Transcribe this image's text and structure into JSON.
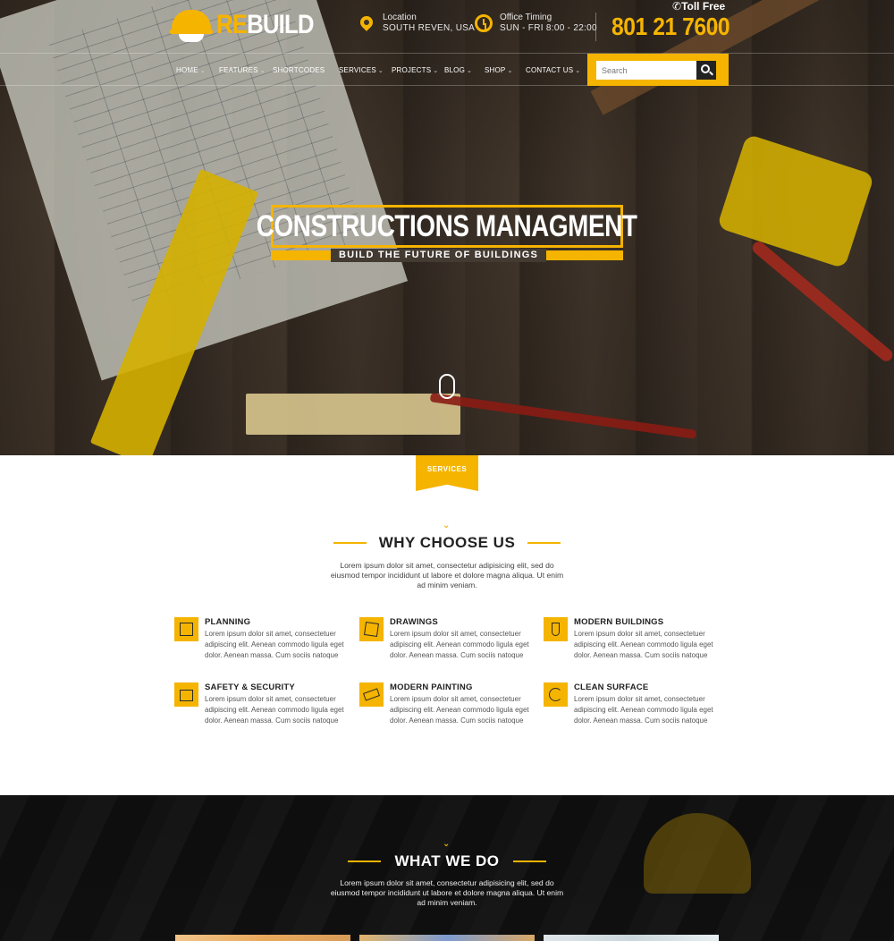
{
  "brand": {
    "name_prefix": "RE",
    "name_suffix": "BUILD"
  },
  "header": {
    "location_label": "Location",
    "location_value": "SOUTH REVEN, USA",
    "timing_label": "Office Timing",
    "timing_value": "SUN - FRI 8:00 - 22:00",
    "tollfree_label": "Toll Free",
    "phone": "801 21 7600"
  },
  "nav": {
    "items": [
      {
        "label": "HOME",
        "has_dropdown": true
      },
      {
        "label": "FEATURES",
        "has_dropdown": true
      },
      {
        "label": "SHORTCODES",
        "has_dropdown": false
      },
      {
        "label": "SERVICES",
        "has_dropdown": true
      },
      {
        "label": "PROJECTS",
        "has_dropdown": true
      },
      {
        "label": "BLOG",
        "has_dropdown": true
      },
      {
        "label": "SHOP",
        "has_dropdown": true
      },
      {
        "label": "CONTACT US",
        "has_dropdown": true
      }
    ],
    "search_placeholder": "Search"
  },
  "hero": {
    "title": "CONSTRUCTIONS MANAGMENT",
    "subtitle": "BUILD THE FUTURE OF BUILDINGS"
  },
  "services": {
    "tag": "SERVICES",
    "heading": "WHY CHOOSE US",
    "intro": "Lorem ipsum dolor sit amet, consectetur adipisicing elit, sed do eiusmod tempor incididunt ut labore et dolore magna aliqua. Ut enim ad minim veniam.",
    "features": [
      {
        "title": "PLANNING",
        "icon": "planning-icon",
        "desc": "Lorem ipsum dolor sit amet, consectetuer adipiscing elit. Aenean commodo ligula eget dolor. Aenean massa. Cum sociis natoque"
      },
      {
        "title": "DRAWINGS",
        "icon": "drawings-icon",
        "desc": "Lorem ipsum dolor sit amet, consectetuer adipiscing elit. Aenean commodo ligula eget dolor. Aenean massa. Cum sociis natoque"
      },
      {
        "title": "MODERN BUILDINGS",
        "icon": "modern-buildings-icon",
        "desc": "Lorem ipsum dolor sit amet, consectetuer adipiscing elit. Aenean commodo ligula eget dolor. Aenean massa. Cum sociis natoque"
      },
      {
        "title": "SAFETY & SECURITY",
        "icon": "safety-icon",
        "desc": "Lorem ipsum dolor sit amet, consectetuer adipiscing elit. Aenean commodo ligula eget dolor. Aenean massa. Cum sociis natoque"
      },
      {
        "title": "MODERN PAINTING",
        "icon": "painting-icon",
        "desc": "Lorem ipsum dolor sit amet, consectetuer adipiscing elit. Aenean commodo ligula eget dolor. Aenean massa. Cum sociis natoque"
      },
      {
        "title": "CLEAN SURFACE",
        "icon": "clean-surface-icon",
        "desc": "Lorem ipsum dolor sit amet, consectetuer adipiscing elit. Aenean commodo ligula eget dolor. Aenean massa. Cum sociis natoque"
      }
    ]
  },
  "what_we_do": {
    "heading": "WHAT WE DO",
    "intro": "Lorem ipsum dolor sit amet, consectetur adipisicing elit, sed do eiusmod tempor incididunt ut labore et dolore magna aliqua. Ut enim ad minim veniam."
  },
  "colors": {
    "accent": "#f5b400",
    "dark": "#222222",
    "text": "#333333"
  }
}
